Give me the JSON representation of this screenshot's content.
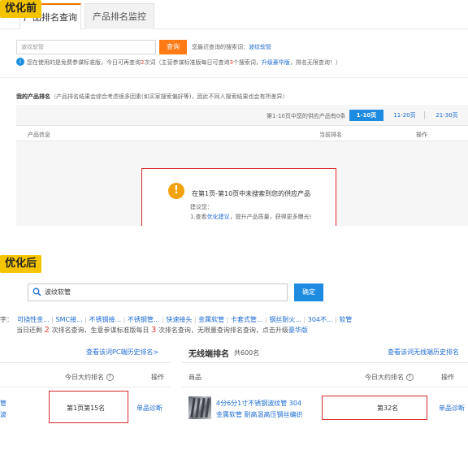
{
  "before": {
    "badge": "优化前",
    "tabs": [
      {
        "label": "产品排名查询"
      },
      {
        "label": "产品排名监控"
      }
    ],
    "search": {
      "value": "波纹软管",
      "button": "查询"
    },
    "recent": {
      "label": "您最近查询的搜索词：",
      "term": "波纹软管"
    },
    "notice": {
      "part1": "您在使用的是免费参谋标准版，今日可再查询",
      "count1": "2",
      "part2": "次词（主营参谋标准版每日可查询",
      "count2": "3",
      "part3": "个搜索词，",
      "upgrade": "升级豪华版",
      "part4": "，排名无限查询！）"
    },
    "section": {
      "title": "我的产品排名",
      "note": "（产品排名结果会综合考虑很多因素(如买家搜索偏好等)，因此不同人搜索结果也会有所差异）"
    },
    "pager": {
      "info": "第1-10页中您的供应产品有0条",
      "pages": [
        "1-10页",
        "11-20页",
        "21-30页"
      ]
    },
    "columns": {
      "product": "产品信息",
      "rank": "当前排名",
      "action": "操作"
    },
    "empty": {
      "icon": "!",
      "title": "在第1页-第10页中未搜索到您的供应产品",
      "suggest": "建议您：",
      "tip_prefix": "1.查看",
      "tip_link": "优化建议",
      "tip_suffix": "，提升产品质量，获得更多曝光!"
    }
  },
  "after": {
    "badge": "优化后",
    "search": {
      "value": "波纹软管",
      "button": "确定"
    },
    "keywords_prefix": "字：",
    "keywords": [
      "可挠性金...",
      "SMC接...",
      "不锈钢接...",
      "不锈钢管...",
      "快速接头",
      "金属软管",
      "卡套式管...",
      "钢丝耐火...",
      "304不...",
      "软管"
    ],
    "notice": {
      "part1": "当日还剩",
      "count1": "2",
      "part2": "次排名查询，生意参谋标准版每日",
      "count2": "3",
      "part3": "次排名查询，无限量查询排名查询，点击升级",
      "upgrade": "豪华版"
    },
    "pc_section": {
      "history_link": "查看该词PC端历史排名>",
      "columns": {
        "rank": "今日大约排名",
        "action": "操作"
      },
      "row": {
        "name_line1": "管",
        "name_line2": "波",
        "rank": "第1页第15名",
        "action": "单品诊断"
      }
    },
    "wireless_section": {
      "title": "无线端排名",
      "count": "共600名",
      "history_link": "查看该词无线端历史排名",
      "columns": {
        "product": "商品",
        "rank": "今日大约排名",
        "action": "操作"
      },
      "row": {
        "name_line1": "4分6分1寸不锈钢波纹管 304",
        "name_line2": "金属软管 耐高温高压钢丝编织",
        "rank": "第32名",
        "action": "单品诊断"
      }
    },
    "help_icon": "?"
  },
  "colors": {
    "badge": "#f5c400",
    "tab_accent": "#ff7300",
    "link": "#1b6bd1",
    "primary_blue": "#1d8ce0",
    "highlight_red": "#d62828",
    "count_red": "#e53935"
  }
}
